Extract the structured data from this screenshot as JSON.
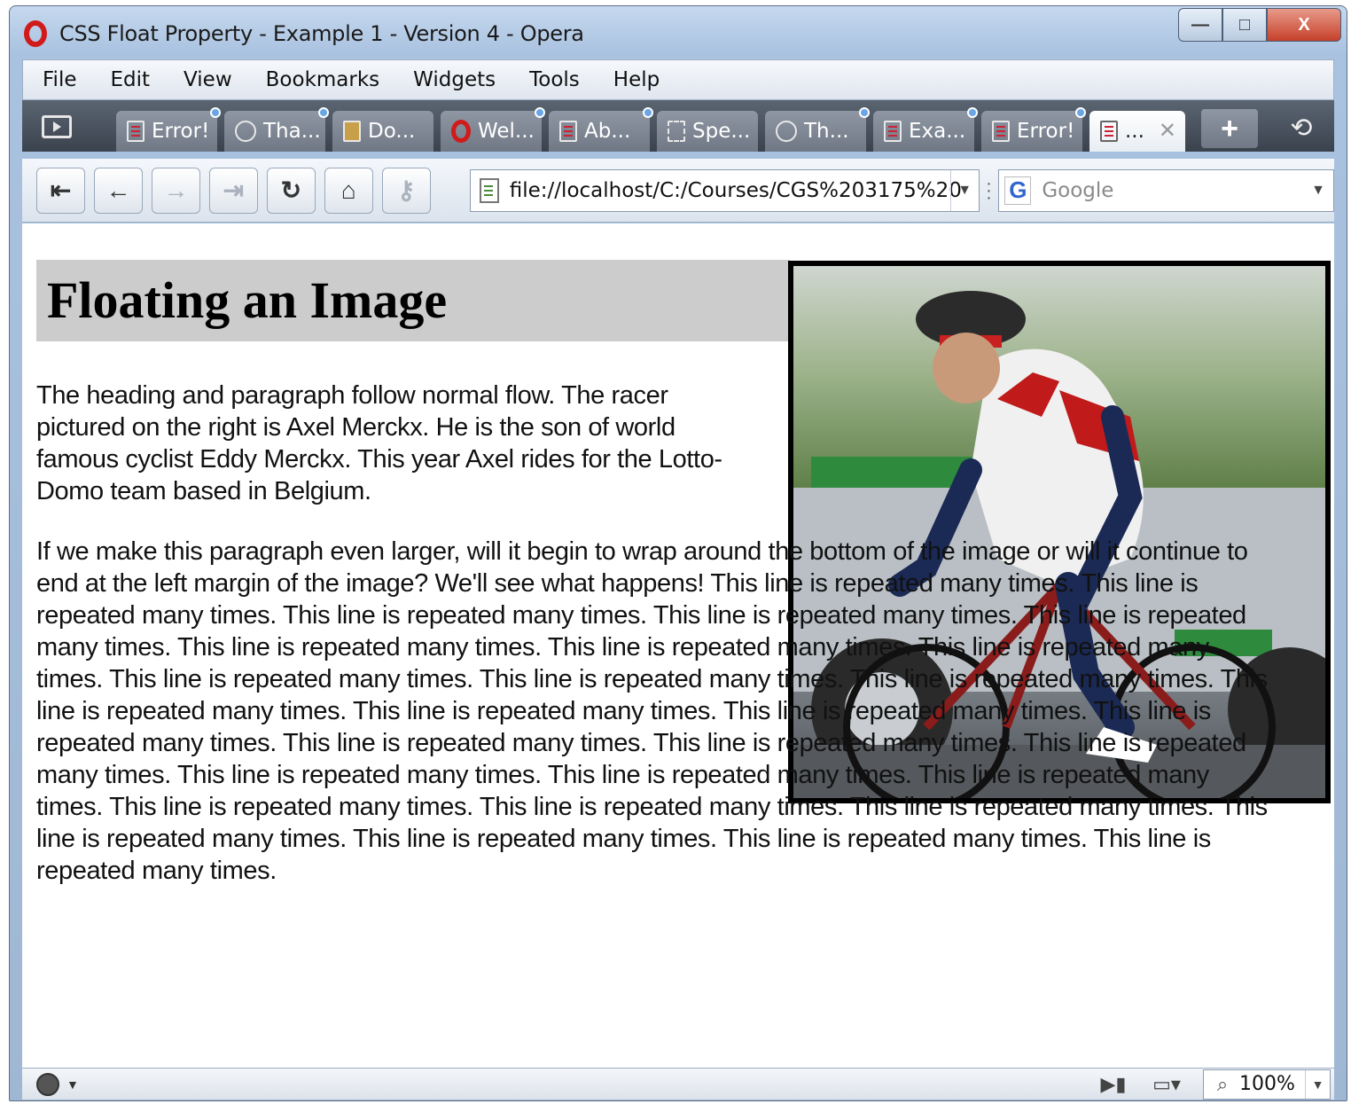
{
  "window": {
    "title": "CSS Float Property - Example 1 - Version 4 - Opera",
    "controls": {
      "minimize": "—",
      "maximize": "□",
      "close": "X"
    }
  },
  "menu": {
    "items": [
      "File",
      "Edit",
      "View",
      "Bookmarks",
      "Widgets",
      "Tools",
      "Help"
    ]
  },
  "tabs": [
    {
      "label": "Error!",
      "icon": "document-icon"
    },
    {
      "label": "Tha...",
      "icon": "chat-bubble-icon"
    },
    {
      "label": "Do...",
      "icon": "download-icon"
    },
    {
      "label": "Wel...",
      "icon": "opera-icon"
    },
    {
      "label": "Ab...",
      "icon": "document-icon"
    },
    {
      "label": "Spe...",
      "icon": "speed-dial-icon"
    },
    {
      "label": "Th...",
      "icon": "chat-bubble-icon"
    },
    {
      "label": "Exa...",
      "icon": "document-icon"
    },
    {
      "label": "Error!",
      "icon": "document-icon"
    }
  ],
  "active_tab": {
    "label": "...",
    "close": "✕"
  },
  "toolbar": {
    "address": "file://localhost/C:/Courses/CGS%203175%20-%",
    "search_engine_icon": "G",
    "search_placeholder": "Google"
  },
  "page": {
    "heading": "Floating an Image",
    "image_alt": "Cyclist Axel Merckx",
    "paragraph1": "The heading and paragraph follow normal flow. The racer pictured on the right is Axel Merckx. He is the son of world famous cyclist Eddy Merckx. This year Axel rides for the Lotto-Domo team based in Belgium.",
    "paragraph2": "If we make this paragraph even larger, will it begin to wrap around the bottom of the image or will it continue to end at the left margin of the image? We'll see what happens! This line is repeated many times. This line is repeated many times. This line is repeated many times. This line is repeated many times. This line is repeated many times. This line is repeated many times. This line is repeated many times. This line is repeated many times. This line is repeated many times. This line is repeated many times. This line is repeated many times. This line is repeated many times. This line is repeated many times. This line is repeated many times. This line is repeated many times. This line is repeated many times. This line is repeated many times. This line is repeated many times. This line is repeated many times. This line is repeated many times. This line is repeated many times. This line is repeated many times. This line is repeated many times. This line is repeated many times. This line is repeated many times. This line is repeated many times. This line is repeated many times. This line is repeated many times."
  },
  "status": {
    "zoom": "100%"
  },
  "colors": {
    "heading_background": "#cccccc",
    "tab_bar": "#4a525d",
    "opera_red": "#d11a1a"
  }
}
